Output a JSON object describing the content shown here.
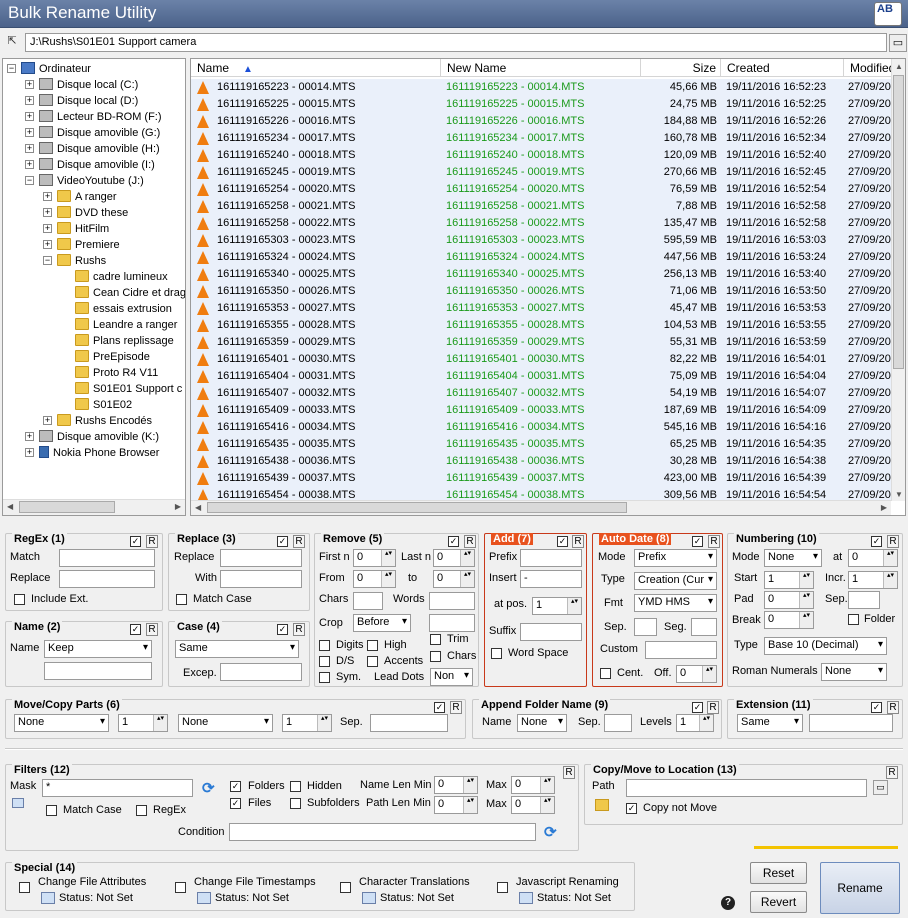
{
  "window": {
    "title": "Bulk Rename Utility",
    "icon_text": "AB"
  },
  "path": {
    "value": "J:\\Rushs\\S01E01 Support camera"
  },
  "tree": {
    "items": [
      {
        "label": "Ordinateur",
        "icon": "computer-icon"
      },
      {
        "label": "Disque local (C:)",
        "icon": "drive-icon"
      },
      {
        "label": "Disque local (D:)",
        "icon": "drive-icon"
      },
      {
        "label": "Lecteur BD-ROM (F:)",
        "icon": "disc-icon"
      },
      {
        "label": "Disque amovible (G:)",
        "icon": "drive-icon"
      },
      {
        "label": "Disque amovible (H:)",
        "icon": "drive-icon"
      },
      {
        "label": "Disque amovible (I:)",
        "icon": "drive-icon"
      },
      {
        "label": "VideoYoutube (J:)",
        "icon": "drive-icon"
      },
      {
        "label": "A ranger",
        "icon": "folder-icon"
      },
      {
        "label": "DVD these",
        "icon": "folder-icon"
      },
      {
        "label": "HitFilm",
        "icon": "folder-icon"
      },
      {
        "label": "Premiere",
        "icon": "folder-icon"
      },
      {
        "label": "Rushs",
        "icon": "folder-icon"
      },
      {
        "label": "cadre lumineux",
        "icon": "folder-icon"
      },
      {
        "label": "Cean Cidre et drag",
        "icon": "folder-icon"
      },
      {
        "label": "essais extrusion",
        "icon": "folder-icon"
      },
      {
        "label": "Leandre a ranger",
        "icon": "folder-icon"
      },
      {
        "label": "Plans replissage",
        "icon": "folder-icon"
      },
      {
        "label": "PreEpisode",
        "icon": "folder-icon"
      },
      {
        "label": "Proto R4 V11",
        "icon": "folder-icon"
      },
      {
        "label": "S01E01 Support c",
        "icon": "folder-icon"
      },
      {
        "label": "S01E02",
        "icon": "folder-icon"
      },
      {
        "label": "Rushs Encodés",
        "icon": "folder-icon"
      },
      {
        "label": "Disque amovible (K:)",
        "icon": "drive-icon"
      },
      {
        "label": "Nokia Phone Browser",
        "icon": "phone-icon"
      }
    ]
  },
  "filelist": {
    "columns": {
      "name": "Name",
      "new_name": "New Name",
      "size": "Size",
      "created": "Created",
      "modified": "Modified"
    },
    "rows": [
      {
        "name": "161119165223 - 00014.MTS",
        "new_name": "161119165223 - 00014.MTS",
        "size": "45,66 MB",
        "created": "19/11/2016 16:52:23",
        "modified": "27/09/20"
      },
      {
        "name": "161119165225 - 00015.MTS",
        "new_name": "161119165225 - 00015.MTS",
        "size": "24,75 MB",
        "created": "19/11/2016 16:52:25",
        "modified": "27/09/20"
      },
      {
        "name": "161119165226 - 00016.MTS",
        "new_name": "161119165226 - 00016.MTS",
        "size": "184,88 MB",
        "created": "19/11/2016 16:52:26",
        "modified": "27/09/20"
      },
      {
        "name": "161119165234 - 00017.MTS",
        "new_name": "161119165234 - 00017.MTS",
        "size": "160,78 MB",
        "created": "19/11/2016 16:52:34",
        "modified": "27/09/20"
      },
      {
        "name": "161119165240 - 00018.MTS",
        "new_name": "161119165240 - 00018.MTS",
        "size": "120,09 MB",
        "created": "19/11/2016 16:52:40",
        "modified": "27/09/20"
      },
      {
        "name": "161119165245 - 00019.MTS",
        "new_name": "161119165245 - 00019.MTS",
        "size": "270,66 MB",
        "created": "19/11/2016 16:52:45",
        "modified": "27/09/20"
      },
      {
        "name": "161119165254 - 00020.MTS",
        "new_name": "161119165254 - 00020.MTS",
        "size": "76,59 MB",
        "created": "19/11/2016 16:52:54",
        "modified": "27/09/20"
      },
      {
        "name": "161119165258 - 00021.MTS",
        "new_name": "161119165258 - 00021.MTS",
        "size": "7,88 MB",
        "created": "19/11/2016 16:52:58",
        "modified": "27/09/20"
      },
      {
        "name": "161119165258 - 00022.MTS",
        "new_name": "161119165258 - 00022.MTS",
        "size": "135,47 MB",
        "created": "19/11/2016 16:52:58",
        "modified": "27/09/20"
      },
      {
        "name": "161119165303 - 00023.MTS",
        "new_name": "161119165303 - 00023.MTS",
        "size": "595,59 MB",
        "created": "19/11/2016 16:53:03",
        "modified": "27/09/20"
      },
      {
        "name": "161119165324 - 00024.MTS",
        "new_name": "161119165324 - 00024.MTS",
        "size": "447,56 MB",
        "created": "19/11/2016 16:53:24",
        "modified": "27/09/20"
      },
      {
        "name": "161119165340 - 00025.MTS",
        "new_name": "161119165340 - 00025.MTS",
        "size": "256,13 MB",
        "created": "19/11/2016 16:53:40",
        "modified": "27/09/20"
      },
      {
        "name": "161119165350 - 00026.MTS",
        "new_name": "161119165350 - 00026.MTS",
        "size": "71,06 MB",
        "created": "19/11/2016 16:53:50",
        "modified": "27/09/20"
      },
      {
        "name": "161119165353 - 00027.MTS",
        "new_name": "161119165353 - 00027.MTS",
        "size": "45,47 MB",
        "created": "19/11/2016 16:53:53",
        "modified": "27/09/20"
      },
      {
        "name": "161119165355 - 00028.MTS",
        "new_name": "161119165355 - 00028.MTS",
        "size": "104,53 MB",
        "created": "19/11/2016 16:53:55",
        "modified": "27/09/20"
      },
      {
        "name": "161119165359 - 00029.MTS",
        "new_name": "161119165359 - 00029.MTS",
        "size": "55,31 MB",
        "created": "19/11/2016 16:53:59",
        "modified": "27/09/20"
      },
      {
        "name": "161119165401 - 00030.MTS",
        "new_name": "161119165401 - 00030.MTS",
        "size": "82,22 MB",
        "created": "19/11/2016 16:54:01",
        "modified": "27/09/20"
      },
      {
        "name": "161119165404 - 00031.MTS",
        "new_name": "161119165404 - 00031.MTS",
        "size": "75,09 MB",
        "created": "19/11/2016 16:54:04",
        "modified": "27/09/20"
      },
      {
        "name": "161119165407 - 00032.MTS",
        "new_name": "161119165407 - 00032.MTS",
        "size": "54,19 MB",
        "created": "19/11/2016 16:54:07",
        "modified": "27/09/20"
      },
      {
        "name": "161119165409 - 00033.MTS",
        "new_name": "161119165409 - 00033.MTS",
        "size": "187,69 MB",
        "created": "19/11/2016 16:54:09",
        "modified": "27/09/20"
      },
      {
        "name": "161119165416 - 00034.MTS",
        "new_name": "161119165416 - 00034.MTS",
        "size": "545,16 MB",
        "created": "19/11/2016 16:54:16",
        "modified": "27/09/20"
      },
      {
        "name": "161119165435 - 00035.MTS",
        "new_name": "161119165435 - 00035.MTS",
        "size": "65,25 MB",
        "created": "19/11/2016 16:54:35",
        "modified": "27/09/20"
      },
      {
        "name": "161119165438 - 00036.MTS",
        "new_name": "161119165438 - 00036.MTS",
        "size": "30,28 MB",
        "created": "19/11/2016 16:54:38",
        "modified": "27/09/20"
      },
      {
        "name": "161119165439 - 00037.MTS",
        "new_name": "161119165439 - 00037.MTS",
        "size": "423,00 MB",
        "created": "19/11/2016 16:54:39",
        "modified": "27/09/20"
      },
      {
        "name": "161119165454 - 00038.MTS",
        "new_name": "161119165454 - 00038.MTS",
        "size": "309,56 MB",
        "created": "19/11/2016 16:54:54",
        "modified": "27/09/20"
      }
    ]
  },
  "regex": {
    "title": "RegEx (1)",
    "match_label": "Match",
    "replace_label": "Replace",
    "include_ext_label": "Include Ext."
  },
  "replace": {
    "title": "Replace (3)",
    "replace_label": "Replace",
    "with_label": "With",
    "match_case_label": "Match Case"
  },
  "remove": {
    "title": "Remove (5)",
    "first_n_label": "First n",
    "first_n": "0",
    "last_n_label": "Last n",
    "last_n": "0",
    "from_label": "From",
    "from": "0",
    "to_label": "to",
    "to": "0",
    "chars_label": "Chars",
    "words_label": "Words",
    "crop_label": "Crop",
    "crop": "Before",
    "digits_label": "Digits",
    "high_label": "High",
    "trim_label": "Trim",
    "ds_label": "D/S",
    "accents_label": "Accents",
    "chars2_label": "Chars",
    "sym_label": "Sym.",
    "lead_dots_label": "Lead Dots",
    "lead_dots": "Non"
  },
  "add": {
    "title": "Add (7)",
    "prefix_label": "Prefix",
    "insert_label": "Insert",
    "insert": "-",
    "at_pos_label": "at pos.",
    "at_pos": "1",
    "suffix_label": "Suffix",
    "word_space_label": "Word Space"
  },
  "autodate": {
    "title": "Auto Date (8)",
    "mode_label": "Mode",
    "mode": "Prefix",
    "type_label": "Type",
    "type": "Creation (Cur",
    "fmt_label": "Fmt",
    "fmt": "YMD HMS",
    "sep_label": "Sep.",
    "seg_label": "Seg.",
    "custom_label": "Custom",
    "cent_label": "Cent.",
    "off_label": "Off.",
    "off": "0"
  },
  "numbering": {
    "title": "Numbering (10)",
    "mode_label": "Mode",
    "mode": "None",
    "at_label": "at",
    "at": "0",
    "start_label": "Start",
    "start": "1",
    "incr_label": "Incr.",
    "incr": "1",
    "pad_label": "Pad",
    "pad": "0",
    "sep_label": "Sep.",
    "break_label": "Break",
    "break": "0",
    "folder_label": "Folder",
    "type_label": "Type",
    "type": "Base 10 (Decimal)",
    "roman_label": "Roman Numerals",
    "roman": "None"
  },
  "name": {
    "title": "Name (2)",
    "name_label": "Name",
    "name_mode": "Keep"
  },
  "case": {
    "title": "Case (4)",
    "case_mode": "Same",
    "excep_label": "Excep."
  },
  "movecopy": {
    "title": "Move/Copy Parts (6)",
    "mode1": "None",
    "count1": "1",
    "mode2": "None",
    "count2": "1",
    "sep_label": "Sep."
  },
  "appendfolder": {
    "title": "Append Folder Name (9)",
    "name_label": "Name",
    "name_mode": "None",
    "sep_label": "Sep.",
    "levels_label": "Levels",
    "levels": "1"
  },
  "extension": {
    "title": "Extension (11)",
    "mode": "Same"
  },
  "filters": {
    "title": "Filters (12)",
    "mask_label": "Mask",
    "mask": "*",
    "folders_label": "Folders",
    "hidden_label": "Hidden",
    "files_label": "Files",
    "subfolders_label": "Subfolders",
    "name_len_min_label": "Name Len Min",
    "name_len_min": "0",
    "name_max_label": "Max",
    "name_max": "0",
    "path_len_min_label": "Path Len Min",
    "path_len_min": "0",
    "path_max_label": "Max",
    "path_max": "0",
    "match_case_label": "Match Case",
    "regex_label": "RegEx",
    "condition_label": "Condition"
  },
  "copymove": {
    "title": "Copy/Move to Location (13)",
    "path_label": "Path",
    "copy_not_move_label": "Copy not Move"
  },
  "special": {
    "title": "Special (14)",
    "items": [
      {
        "label": "Change File Attributes",
        "status": "Status: Not Set"
      },
      {
        "label": "Change File Timestamps",
        "status": "Status: Not Set"
      },
      {
        "label": "Character Translations",
        "status": "Status: Not Set"
      },
      {
        "label": "Javascript Renaming",
        "status": "Status: Not Set"
      }
    ]
  },
  "buttons": {
    "reset": "Reset",
    "revert": "Revert",
    "rename": "Rename",
    "r_label": "R",
    "help": "?"
  }
}
